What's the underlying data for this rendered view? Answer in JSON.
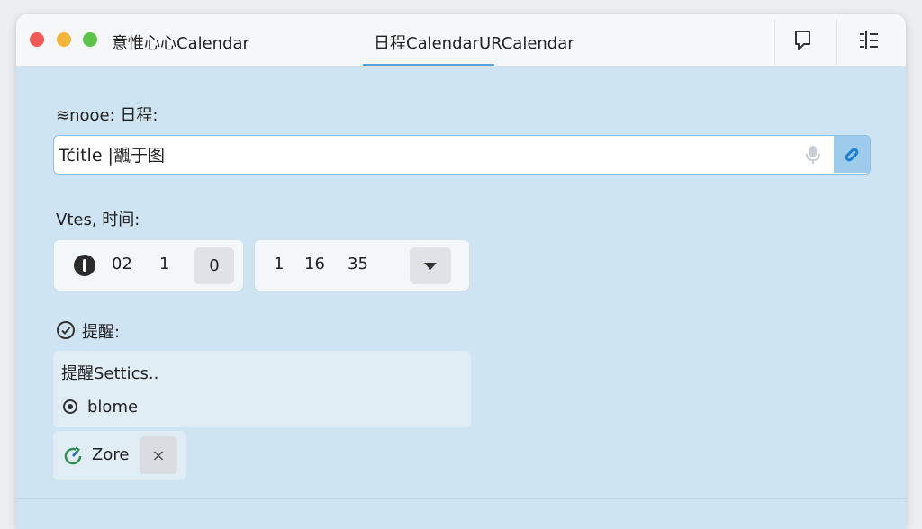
{
  "window": {
    "app_title": "意惟心心Calendar",
    "tab_label": "日程CalendarURCalendar"
  },
  "form": {
    "name_label": "≋nooe: 日程:",
    "title_input": {
      "value": "Tćitle |飁于图",
      "placeholder": ""
    },
    "time_label": "Vtes, 时间:",
    "date_fields": [
      "02",
      "1",
      "0"
    ],
    "time_fields": [
      "1",
      "16",
      "35"
    ],
    "reminder_label": "提醒:",
    "reminder_settings_label": "提醒Settics..",
    "reminder_option": "blome",
    "zone_label": "Zore",
    "zone_clear": "×"
  },
  "colors": {
    "accent": "#5aa0d8",
    "window_bg": "#cfe4f2",
    "titlebar_bg": "#f6f7f8"
  }
}
